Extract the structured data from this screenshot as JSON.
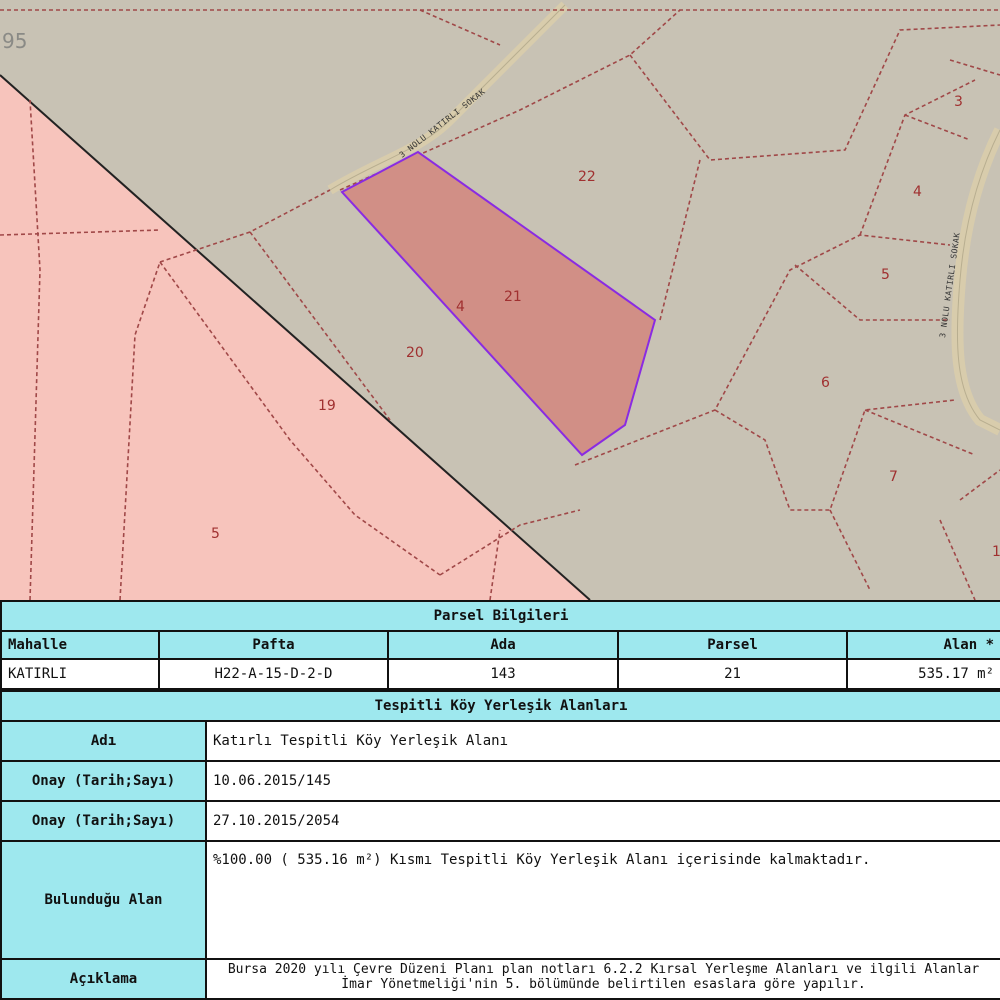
{
  "map": {
    "corner_number": "95",
    "road_label_top": "3 NOLU KATIRLI SOKAK",
    "road_label_right": "3 NOLU KATIRLI SOKAK",
    "parcels": [
      "22",
      "21",
      "4",
      "20",
      "19",
      "5",
      "3",
      "4",
      "5",
      "6",
      "7",
      "1"
    ],
    "colors": {
      "zone_pink": "#f7c4bc",
      "zone_grey": "#c8c2b4",
      "selected_fill": "#d18f86",
      "selected_outline": "#8a2be2",
      "boundary": "#a04848",
      "road": "#d8ccac"
    }
  },
  "parsel": {
    "title": "Parsel Bilgileri",
    "headers": [
      "Mahalle",
      "Pafta",
      "Ada",
      "Parsel",
      "Alan *"
    ],
    "values": [
      "KATIRLI",
      "H22-A-15-D-2-D",
      "143",
      "21",
      "535.17 m²"
    ]
  },
  "koy": {
    "title": "Tespitli Köy Yerleşik Alanları",
    "rows": [
      {
        "label": "Adı",
        "value": "Katırlı Tespitli Köy Yerleşik Alanı"
      },
      {
        "label": "Onay (Tarih;Sayı)",
        "value": "10.06.2015/145"
      },
      {
        "label": "Onay (Tarih;Sayı)",
        "value": "27.10.2015/2054"
      },
      {
        "label": "Bulunduğu Alan",
        "value": "%100.00 ( 535.16 m²) Kısmı Tespitli Köy Yerleşik Alanı içerisinde kalmaktadır."
      },
      {
        "label": "Açıklama",
        "value": "Bursa 2020 yılı Çevre Düzeni Planı plan notları 6.2.2 Kırsal Yerleşme Alanları ve ilgili Alanlar İmar Yönetmeliği'nin 5. bölümünde belirtilen esaslara göre yapılır."
      }
    ]
  }
}
